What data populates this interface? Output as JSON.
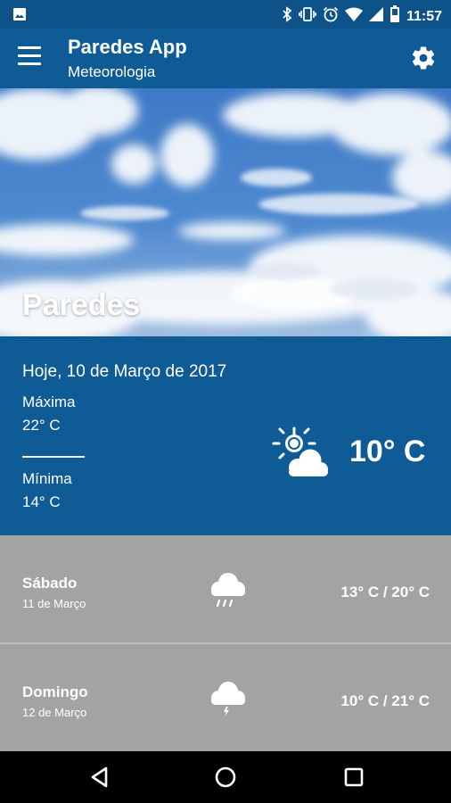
{
  "status_bar": {
    "time": "11:57",
    "icons": [
      "image-icon",
      "bluetooth-icon",
      "vibrate-icon",
      "alarm-icon",
      "wifi-icon",
      "signal-icon",
      "battery-icon"
    ]
  },
  "app_bar": {
    "title": "Paredes App",
    "subtitle": "Meteorologia",
    "menu_icon": "hamburger-menu-icon",
    "settings_icon": "gear-icon"
  },
  "hero": {
    "city": "Paredes"
  },
  "today": {
    "date": "Hoje, 10 de Março de 2017",
    "max_label": "Máxima",
    "max_value": "22° C",
    "min_label": "Mínima",
    "min_value": "14° C",
    "current_temp": "10° C",
    "icon": "sun-behind-cloud-icon"
  },
  "forecast": [
    {
      "day": "Sábado",
      "date": "11 de Março",
      "range": "13° C / 20° C",
      "icon": "rain-cloud-icon"
    },
    {
      "day": "Domingo",
      "date": "12 de Março",
      "range": "10° C / 21° C",
      "icon": "storm-cloud-icon"
    }
  ],
  "nav_bar": {
    "icons": [
      "back-icon",
      "home-icon",
      "recents-icon"
    ]
  },
  "colors": {
    "primary": "#0f5b95",
    "status_bar": "#0d5288",
    "forecast_bg": "#a3a3a3"
  }
}
